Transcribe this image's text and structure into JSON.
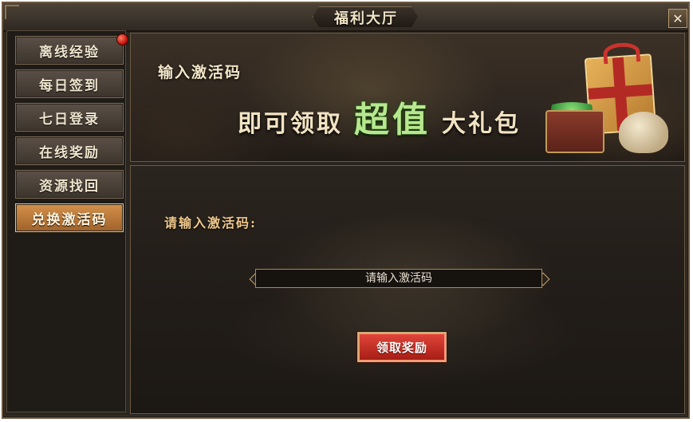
{
  "window": {
    "title": "福利大厅",
    "close_icon": "close-icon",
    "close_glyph": "✕"
  },
  "sidebar": {
    "items": [
      {
        "label": "离线经验",
        "active": false,
        "notification_dot": true
      },
      {
        "label": "每日签到",
        "active": false
      },
      {
        "label": "七日登录",
        "active": false
      },
      {
        "label": "在线奖励",
        "active": false
      },
      {
        "label": "资源找回",
        "active": false
      },
      {
        "label": "兑换激活码",
        "active": true
      }
    ]
  },
  "banner": {
    "subtitle": "输入激活码",
    "headline_part1": "即可领取",
    "headline_highlight": "超值",
    "headline_part2": "大礼包"
  },
  "redeem": {
    "label": "请输入激活码:",
    "input_placeholder": "请输入激活码",
    "button_label": "领取奖励"
  },
  "colors": {
    "accent_gold": "#f1c98b",
    "active_tab": "#c9813e",
    "button_red": "#c8302a",
    "highlight_green": "#b6e88f"
  }
}
